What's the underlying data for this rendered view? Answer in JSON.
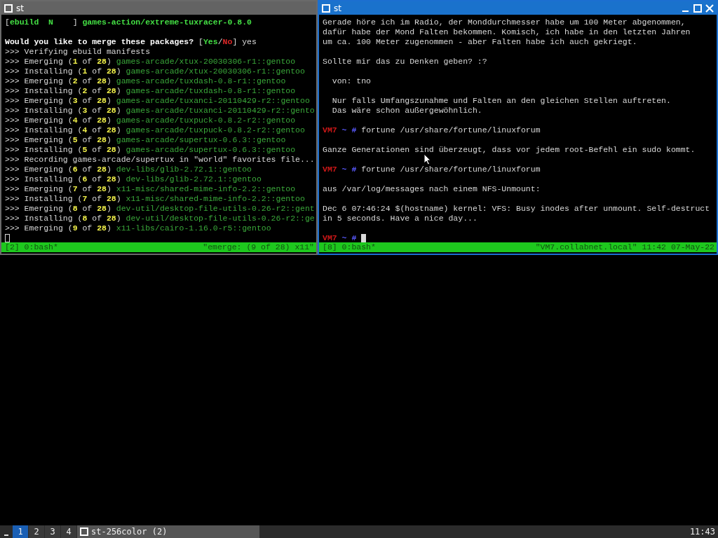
{
  "windows": [
    {
      "title": "st",
      "active": false,
      "lines": [
        {
          "segments": [
            {
              "text": "[",
              "kind": "plain"
            },
            {
              "text": "ebuild  N    ",
              "kind": "bright"
            },
            {
              "text": "] ",
              "kind": "plain"
            },
            {
              "text": "games-action/extreme-tuxracer-0.8.0",
              "kind": "bright"
            }
          ]
        },
        {
          "space_before": true,
          "segments": [
            {
              "text": "Would you like to merge these packages? ",
              "kind": "bold"
            },
            {
              "text": "[",
              "kind": "plain"
            },
            {
              "text": "Yes",
              "kind": "bright"
            },
            {
              "text": "/",
              "kind": "plain"
            },
            {
              "text": "No",
              "kind": "red"
            },
            {
              "text": "] yes",
              "kind": "plain"
            }
          ]
        },
        {
          "segments": [
            {
              "text": ">>> Verifying ebuild manifests",
              "kind": "plain"
            }
          ]
        },
        {
          "segments": [
            {
              "text": ">>> Emerging (",
              "kind": "plain"
            },
            {
              "text": "1",
              "kind": "num"
            },
            {
              "text": " of ",
              "kind": "plain"
            },
            {
              "text": "28",
              "kind": "num"
            },
            {
              "text": ") ",
              "kind": "plain"
            },
            {
              "text": "games-arcade/xtux-20030306-r1::gentoo",
              "kind": "pkg"
            }
          ]
        },
        {
          "segments": [
            {
              "text": ">>> Installing (",
              "kind": "plain"
            },
            {
              "text": "1",
              "kind": "num"
            },
            {
              "text": " of ",
              "kind": "plain"
            },
            {
              "text": "28",
              "kind": "num"
            },
            {
              "text": ") ",
              "kind": "plain"
            },
            {
              "text": "games-arcade/xtux-20030306-r1::gentoo",
              "kind": "pkg"
            }
          ]
        },
        {
          "segments": [
            {
              "text": ">>> Emerging (",
              "kind": "plain"
            },
            {
              "text": "2",
              "kind": "num"
            },
            {
              "text": " of ",
              "kind": "plain"
            },
            {
              "text": "28",
              "kind": "num"
            },
            {
              "text": ") ",
              "kind": "plain"
            },
            {
              "text": "games-arcade/tuxdash-0.8-r1::gentoo",
              "kind": "pkg"
            }
          ]
        },
        {
          "segments": [
            {
              "text": ">>> Installing (",
              "kind": "plain"
            },
            {
              "text": "2",
              "kind": "num"
            },
            {
              "text": " of ",
              "kind": "plain"
            },
            {
              "text": "28",
              "kind": "num"
            },
            {
              "text": ") ",
              "kind": "plain"
            },
            {
              "text": "games-arcade/tuxdash-0.8-r1::gentoo",
              "kind": "pkg"
            }
          ]
        },
        {
          "segments": [
            {
              "text": ">>> Emerging (",
              "kind": "plain"
            },
            {
              "text": "3",
              "kind": "num"
            },
            {
              "text": " of ",
              "kind": "plain"
            },
            {
              "text": "28",
              "kind": "num"
            },
            {
              "text": ") ",
              "kind": "plain"
            },
            {
              "text": "games-arcade/tuxanci-20110429-r2::gentoo",
              "kind": "pkg"
            }
          ]
        },
        {
          "segments": [
            {
              "text": ">>> Installing (",
              "kind": "plain"
            },
            {
              "text": "3",
              "kind": "num"
            },
            {
              "text": " of ",
              "kind": "plain"
            },
            {
              "text": "28",
              "kind": "num"
            },
            {
              "text": ") ",
              "kind": "plain"
            },
            {
              "text": "games-arcade/tuxanci-20110429-r2::gento",
              "kind": "pkg"
            }
          ]
        },
        {
          "segments": [
            {
              "text": ">>> Emerging (",
              "kind": "plain"
            },
            {
              "text": "4",
              "kind": "num"
            },
            {
              "text": " of ",
              "kind": "plain"
            },
            {
              "text": "28",
              "kind": "num"
            },
            {
              "text": ") ",
              "kind": "plain"
            },
            {
              "text": "games-arcade/tuxpuck-0.8.2-r2::gentoo",
              "kind": "pkg"
            }
          ]
        },
        {
          "segments": [
            {
              "text": ">>> Installing (",
              "kind": "plain"
            },
            {
              "text": "4",
              "kind": "num"
            },
            {
              "text": " of ",
              "kind": "plain"
            },
            {
              "text": "28",
              "kind": "num"
            },
            {
              "text": ") ",
              "kind": "plain"
            },
            {
              "text": "games-arcade/tuxpuck-0.8.2-r2::gentoo",
              "kind": "pkg"
            }
          ]
        },
        {
          "segments": [
            {
              "text": ">>> Emerging (",
              "kind": "plain"
            },
            {
              "text": "5",
              "kind": "num"
            },
            {
              "text": " of ",
              "kind": "plain"
            },
            {
              "text": "28",
              "kind": "num"
            },
            {
              "text": ") ",
              "kind": "plain"
            },
            {
              "text": "games-arcade/supertux-0.6.3::gentoo",
              "kind": "pkg"
            }
          ]
        },
        {
          "segments": [
            {
              "text": ">>> Installing (",
              "kind": "plain"
            },
            {
              "text": "5",
              "kind": "num"
            },
            {
              "text": " of ",
              "kind": "plain"
            },
            {
              "text": "28",
              "kind": "num"
            },
            {
              "text": ") ",
              "kind": "plain"
            },
            {
              "text": "games-arcade/supertux-0.6.3::gentoo",
              "kind": "pkg"
            }
          ]
        },
        {
          "segments": [
            {
              "text": ">>> Recording games-arcade/supertux in \"world\" favorites file...",
              "kind": "plain"
            }
          ]
        },
        {
          "segments": [
            {
              "text": ">>> Emerging (",
              "kind": "plain"
            },
            {
              "text": "6",
              "kind": "num"
            },
            {
              "text": " of ",
              "kind": "plain"
            },
            {
              "text": "28",
              "kind": "num"
            },
            {
              "text": ") ",
              "kind": "plain"
            },
            {
              "text": "dev-libs/glib-2.72.1::gentoo",
              "kind": "pkg"
            }
          ]
        },
        {
          "segments": [
            {
              "text": ">>> Installing (",
              "kind": "plain"
            },
            {
              "text": "6",
              "kind": "num"
            },
            {
              "text": " of ",
              "kind": "plain"
            },
            {
              "text": "28",
              "kind": "num"
            },
            {
              "text": ") ",
              "kind": "plain"
            },
            {
              "text": "dev-libs/glib-2.72.1::gentoo",
              "kind": "pkg"
            }
          ]
        },
        {
          "segments": [
            {
              "text": ">>> Emerging (",
              "kind": "plain"
            },
            {
              "text": "7",
              "kind": "num"
            },
            {
              "text": " of ",
              "kind": "plain"
            },
            {
              "text": "28",
              "kind": "num"
            },
            {
              "text": ") ",
              "kind": "plain"
            },
            {
              "text": "x11-misc/shared-mime-info-2.2::gentoo",
              "kind": "pkg"
            }
          ]
        },
        {
          "segments": [
            {
              "text": ">>> Installing (",
              "kind": "plain"
            },
            {
              "text": "7",
              "kind": "num"
            },
            {
              "text": " of ",
              "kind": "plain"
            },
            {
              "text": "28",
              "kind": "num"
            },
            {
              "text": ") ",
              "kind": "plain"
            },
            {
              "text": "x11-misc/shared-mime-info-2.2::gentoo",
              "kind": "pkg"
            }
          ]
        },
        {
          "segments": [
            {
              "text": ">>> Emerging (",
              "kind": "plain"
            },
            {
              "text": "8",
              "kind": "num"
            },
            {
              "text": " of ",
              "kind": "plain"
            },
            {
              "text": "28",
              "kind": "num"
            },
            {
              "text": ") ",
              "kind": "plain"
            },
            {
              "text": "dev-util/desktop-file-utils-0.26-r2::gent",
              "kind": "pkg"
            }
          ]
        },
        {
          "segments": [
            {
              "text": ">>> Installing (",
              "kind": "plain"
            },
            {
              "text": "8",
              "kind": "num"
            },
            {
              "text": " of ",
              "kind": "plain"
            },
            {
              "text": "28",
              "kind": "num"
            },
            {
              "text": ") ",
              "kind": "plain"
            },
            {
              "text": "dev-util/desktop-file-utils-0.26-r2::ge",
              "kind": "pkg"
            }
          ]
        },
        {
          "segments": [
            {
              "text": ">>> Emerging (",
              "kind": "plain"
            },
            {
              "text": "9",
              "kind": "num"
            },
            {
              "text": " of ",
              "kind": "plain"
            },
            {
              "text": "28",
              "kind": "num"
            },
            {
              "text": ") ",
              "kind": "plain"
            },
            {
              "text": "x11-libs/cairo-1.16.0-r5::gentoo",
              "kind": "pkg"
            }
          ]
        },
        {
          "cursor": true
        }
      ],
      "status": {
        "left": "[2] 0:bash*",
        "right": "\"emerge: (9 of 28) x11\""
      }
    },
    {
      "title": "st",
      "active": true,
      "lines": [
        {
          "segments": [
            {
              "text": "Gerade höre ich im Radio, der Monddurchmesser habe um 100 Meter abgenommen,",
              "kind": "plain"
            }
          ]
        },
        {
          "segments": [
            {
              "text": "dafür habe der Mond Falten bekommen. Komisch, ich habe in den letzten Jahren",
              "kind": "plain"
            }
          ]
        },
        {
          "segments": [
            {
              "text": "um ca. 100 Meter zugenommen - aber Falten habe ich auch gekriegt.",
              "kind": "plain"
            }
          ]
        },
        {
          "space_before": true,
          "segments": [
            {
              "text": "Sollte mir das zu Denken geben? :?",
              "kind": "plain"
            }
          ]
        },
        {
          "space_before": true,
          "segments": [
            {
              "text": "  von: tno",
              "kind": "plain"
            }
          ]
        },
        {
          "space_before": true,
          "segments": [
            {
              "text": "  Nur falls Umfangszunahme und Falten an den gleichen Stellen auftreten.",
              "kind": "plain"
            }
          ]
        },
        {
          "segments": [
            {
              "text": "  Das wäre schon außergewöhnlich.",
              "kind": "plain"
            }
          ]
        },
        {
          "space_before": true,
          "segments": [
            {
              "text": "VM7",
              "kind": "host"
            },
            {
              "text": " ~ # ",
              "kind": "prompt"
            },
            {
              "text": "fortune /usr/share/fortune/linuxforum",
              "kind": "plain"
            }
          ]
        },
        {
          "space_before": true,
          "segments": [
            {
              "text": "Ganze Generationen sind überzeugt, dass vor jedem root-Befehl ein sudo kommt.",
              "kind": "plain"
            }
          ]
        },
        {
          "space_before": true,
          "segments": [
            {
              "text": "VM7",
              "kind": "host"
            },
            {
              "text": " ~ # ",
              "kind": "prompt"
            },
            {
              "text": "fortune /usr/share/fortune/linuxforum",
              "kind": "plain"
            }
          ]
        },
        {
          "space_before": true,
          "segments": [
            {
              "text": "aus /var/log/messages nach einem NFS-Unmount:",
              "kind": "plain"
            }
          ]
        },
        {
          "space_before": true,
          "segments": [
            {
              "text": "Dec 6 07:46:24 $(hostname) kernel: VFS: Busy inodes after unmount. Self-destruct",
              "kind": "plain"
            }
          ]
        },
        {
          "segments": [
            {
              "text": "in 5 seconds. Have a nice day...",
              "kind": "plain"
            }
          ]
        },
        {
          "space_before": true,
          "cursor": true,
          "segments": [
            {
              "text": "VM7",
              "kind": "host"
            },
            {
              "text": " ~ # ",
              "kind": "prompt"
            }
          ]
        }
      ],
      "status": {
        "left": "[8] 0:bash*",
        "right": "\"VM7.collabnet.local\" 11:42 07-May-22"
      }
    }
  ],
  "taskbar": {
    "desktops": [
      {
        "label": "1",
        "selected": true
      },
      {
        "label": "2",
        "selected": false
      },
      {
        "label": "3",
        "selected": false
      },
      {
        "label": "4",
        "selected": false
      }
    ],
    "task": "st-256color (2)",
    "clock": "11:43"
  }
}
